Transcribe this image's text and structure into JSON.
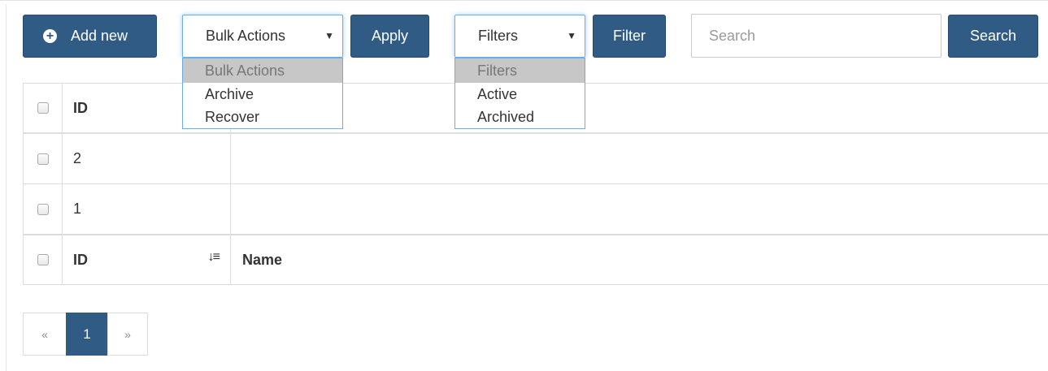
{
  "toolbar": {
    "add_new_label": "Add new",
    "bulk_select_value": "Bulk Actions",
    "apply_label": "Apply",
    "filter_select_value": "Filters",
    "filter_label": "Filter",
    "search_placeholder": "Search",
    "search_label": "Search"
  },
  "bulk_dropdown": {
    "options": [
      "Bulk Actions",
      "Archive",
      "Recover"
    ]
  },
  "filter_dropdown": {
    "options": [
      "Filters",
      "Active",
      "Archived"
    ]
  },
  "table": {
    "header": {
      "id": "ID",
      "name": "Name"
    },
    "rows": [
      {
        "id": "2",
        "name": ""
      },
      {
        "id": "1",
        "name": ""
      }
    ],
    "footer": {
      "id": "ID",
      "name": "Name"
    }
  },
  "pagination": {
    "prev": "«",
    "current": "1",
    "next": "»"
  },
  "colors": {
    "primary": "#2f5b84",
    "focus_border": "#66afe9"
  }
}
